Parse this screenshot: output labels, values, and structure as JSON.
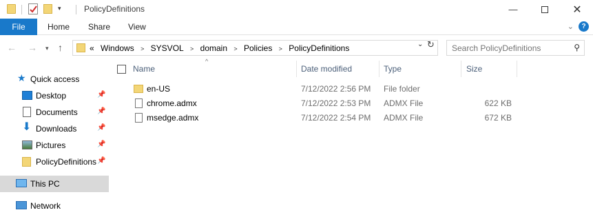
{
  "window": {
    "title": "PolicyDefinitions",
    "minimize_icon": "minimize-icon",
    "maximize_icon": "maximize-icon",
    "close_icon": "close-icon"
  },
  "ribbon": {
    "tabs": [
      {
        "label": "File"
      },
      {
        "label": "Home"
      },
      {
        "label": "Share"
      },
      {
        "label": "View"
      }
    ]
  },
  "address": {
    "overflow": "«",
    "crumbs": [
      "Windows",
      "SYSVOL",
      "domain",
      "Policies",
      "PolicyDefinitions"
    ]
  },
  "search": {
    "placeholder": "Search PolicyDefinitions"
  },
  "nav": {
    "quick_access": "Quick access",
    "items": [
      {
        "label": "Desktop",
        "icon": "desktop-icon"
      },
      {
        "label": "Documents",
        "icon": "documents-icon"
      },
      {
        "label": "Downloads",
        "icon": "downloads-icon"
      },
      {
        "label": "Pictures",
        "icon": "pictures-icon"
      },
      {
        "label": "PolicyDefinitions",
        "icon": "folder-icon"
      }
    ],
    "this_pc": "This PC",
    "network": "Network"
  },
  "columns": {
    "name": "Name",
    "date": "Date modified",
    "type": "Type",
    "size": "Size"
  },
  "files": [
    {
      "name": "en-US",
      "date": "7/12/2022 2:56 PM",
      "type": "File folder",
      "size": ""
    },
    {
      "name": "chrome.admx",
      "date": "7/12/2022 2:53 PM",
      "type": "ADMX File",
      "size": "622 KB"
    },
    {
      "name": "msedge.admx",
      "date": "7/12/2022 2:54 PM",
      "type": "ADMX File",
      "size": "672 KB"
    }
  ],
  "colors": {
    "accent": "#1979ca",
    "header_text": "#4c607a",
    "selected_bg": "#d9d9d9"
  }
}
